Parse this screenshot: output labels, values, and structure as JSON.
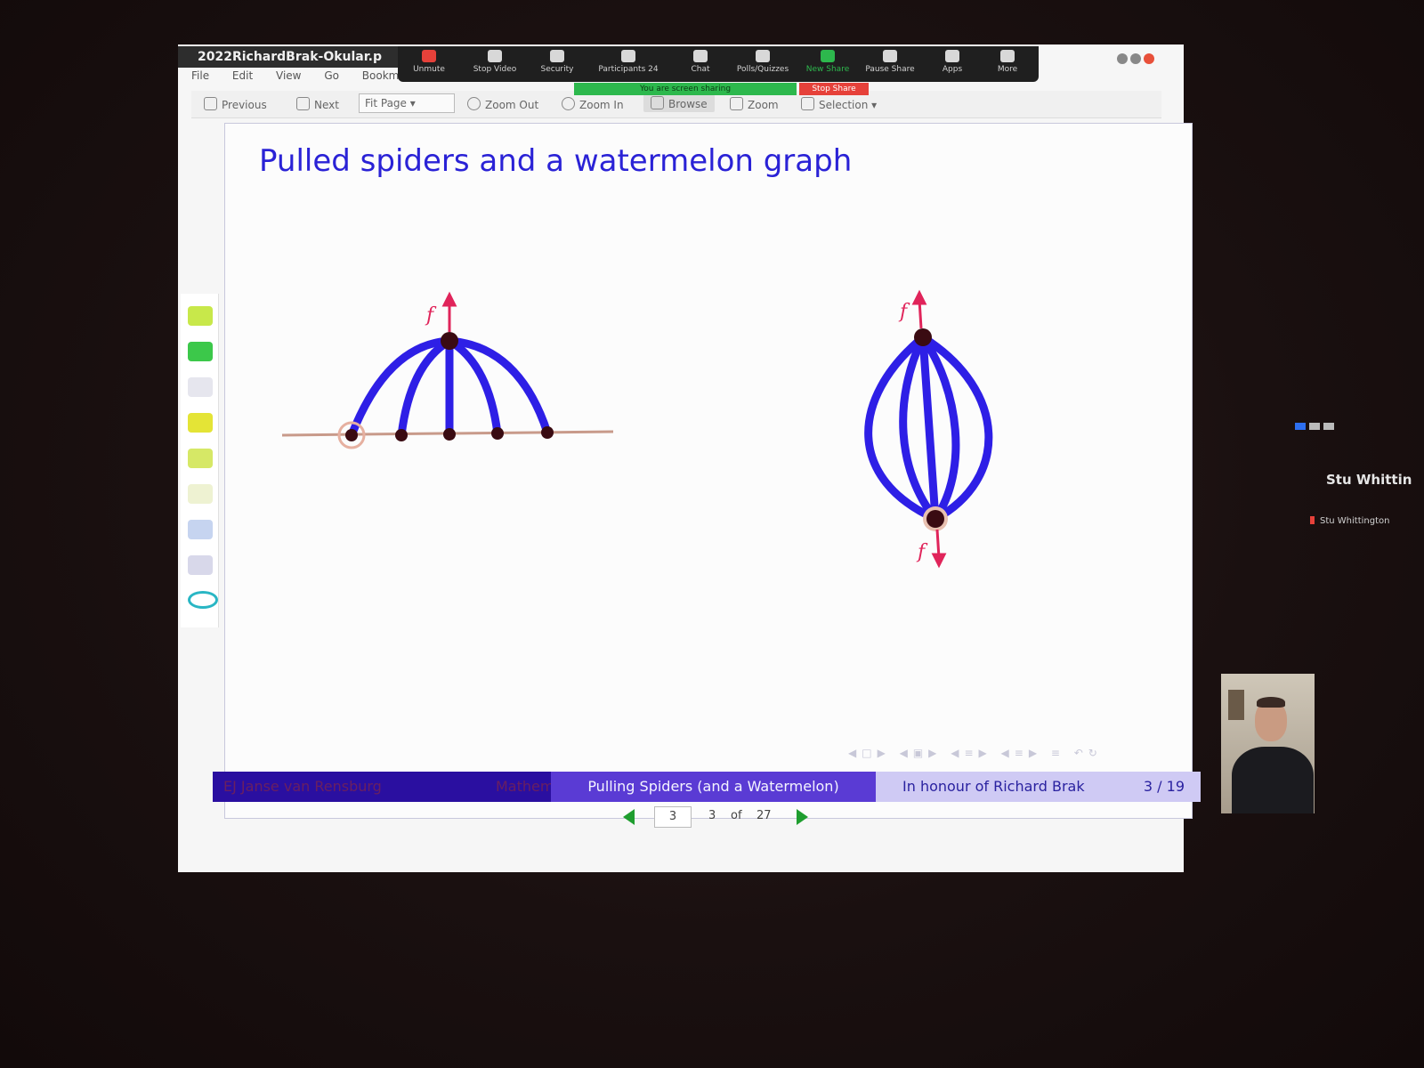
{
  "window": {
    "title": "2022RichardBrak-Okular.p",
    "menu": [
      "File",
      "Edit",
      "View",
      "Go",
      "Bookm"
    ]
  },
  "toolbar": {
    "previous": "Previous",
    "next": "Next",
    "fit_page": "Fit Page",
    "zoom_out": "Zoom Out",
    "zoom_in": "Zoom In",
    "browse": "Browse",
    "zoom": "Zoom",
    "selection": "Selection"
  },
  "meeting_bar": {
    "items": [
      {
        "label": "Unmute",
        "icon": "mic-muted-icon"
      },
      {
        "label": "Stop Video",
        "icon": "video-icon"
      },
      {
        "label": "Security",
        "icon": "shield-icon"
      },
      {
        "label": "Participants",
        "icon": "participants-icon"
      },
      {
        "label": "Chat",
        "icon": "chat-icon"
      },
      {
        "label": "Polls/Quizzes",
        "icon": "poll-icon"
      },
      {
        "label": "New Share",
        "icon": "share-icon"
      },
      {
        "label": "Pause Share",
        "icon": "pause-icon"
      },
      {
        "label": "Apps",
        "icon": "apps-icon"
      },
      {
        "label": "More",
        "icon": "more-icon"
      }
    ],
    "participants_count": "24",
    "sharing_notice": "You are screen sharing",
    "stop_share": "Stop Share",
    "colors": {
      "share_green": "#2db84d",
      "stop_red": "#e6413a"
    }
  },
  "slide": {
    "title": "Pulled spiders and a watermelon graph",
    "force_label": "f",
    "colors": {
      "title": "#2a22d6",
      "edges": "#2e1fe6",
      "force": "#e0245a",
      "vertex": "#3a0b12"
    },
    "footer": {
      "authors": "EJ Janse van Rensburg",
      "affiliation": "Mathem",
      "talk_title": "Pulling Spiders (and a Watermelon)",
      "honour": "In honour of Richard Brak",
      "page": "3 / 19"
    }
  },
  "page_nav": {
    "input_value": "3",
    "current": "3",
    "of": "of",
    "total": "27"
  },
  "zoom_panel": {
    "speaker_name": "Stu Whittin",
    "speaker_label": "Stu Whittington"
  }
}
